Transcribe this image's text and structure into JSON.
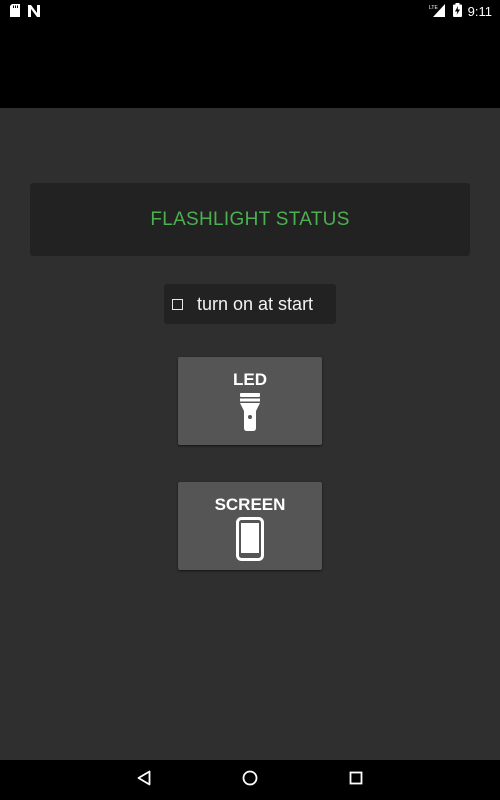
{
  "status_bar": {
    "time": "9:11",
    "network_label": "LTE",
    "icons": [
      "sd-card-icon",
      "n-notification-icon",
      "cell-signal-icon",
      "battery-charging-icon"
    ]
  },
  "app": {
    "status_text": "FLASHLIGHT STATUS",
    "status_color": "#4caf50",
    "start_option": {
      "label": "turn on at start",
      "checked": false
    },
    "led_button": {
      "label": "LED",
      "icon": "flashlight-icon"
    },
    "screen_button": {
      "label": "SCREEN",
      "icon": "smartphone-icon"
    }
  },
  "nav_bar": {
    "icons": [
      "back-icon",
      "home-icon",
      "recents-icon"
    ]
  },
  "colors": {
    "app_background": "#2f2f2f",
    "panel_background": "#222222",
    "button_background": "#555555"
  }
}
